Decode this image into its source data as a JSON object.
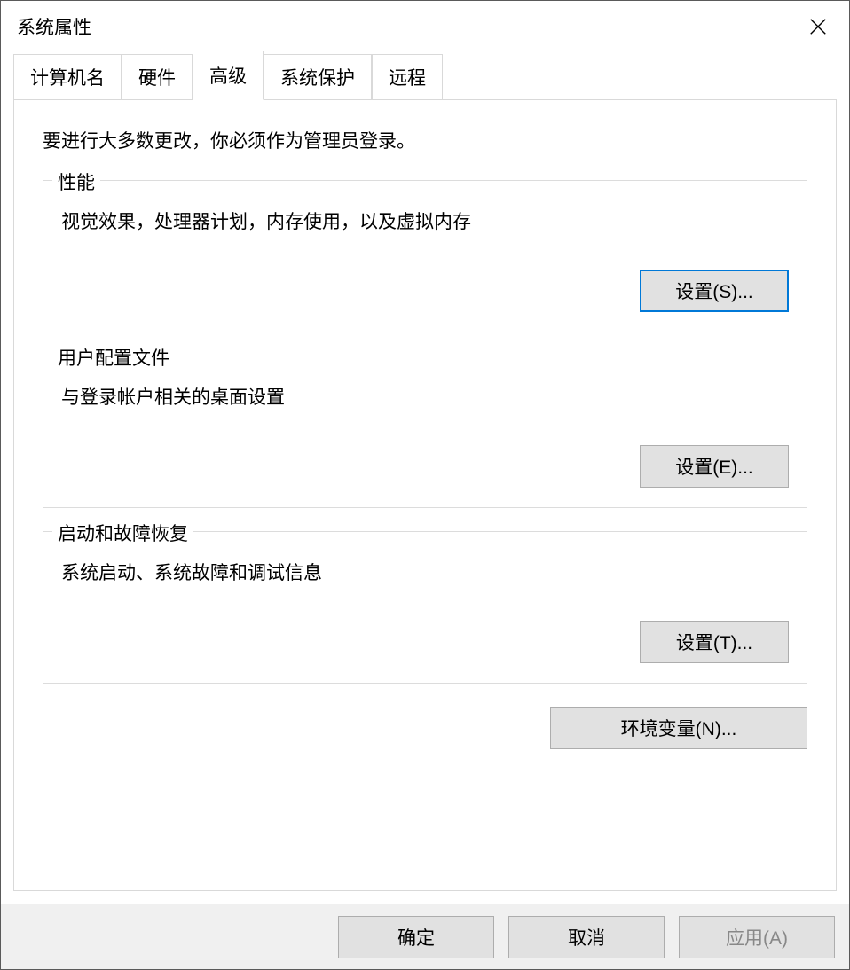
{
  "window": {
    "title": "系统属性"
  },
  "tabs": [
    {
      "label": "计算机名"
    },
    {
      "label": "硬件"
    },
    {
      "label": "高级"
    },
    {
      "label": "系统保护"
    },
    {
      "label": "远程"
    }
  ],
  "panel": {
    "intro": "要进行大多数更改，你必须作为管理员登录。",
    "performance": {
      "legend": "性能",
      "desc": "视觉效果，处理器计划，内存使用，以及虚拟内存",
      "button": "设置(S)..."
    },
    "userProfiles": {
      "legend": "用户配置文件",
      "desc": "与登录帐户相关的桌面设置",
      "button": "设置(E)..."
    },
    "startupRecovery": {
      "legend": "启动和故障恢复",
      "desc": "系统启动、系统故障和调试信息",
      "button": "设置(T)..."
    },
    "envVarsButton": "环境变量(N)..."
  },
  "dialogButtons": {
    "ok": "确定",
    "cancel": "取消",
    "apply": "应用(A)"
  }
}
